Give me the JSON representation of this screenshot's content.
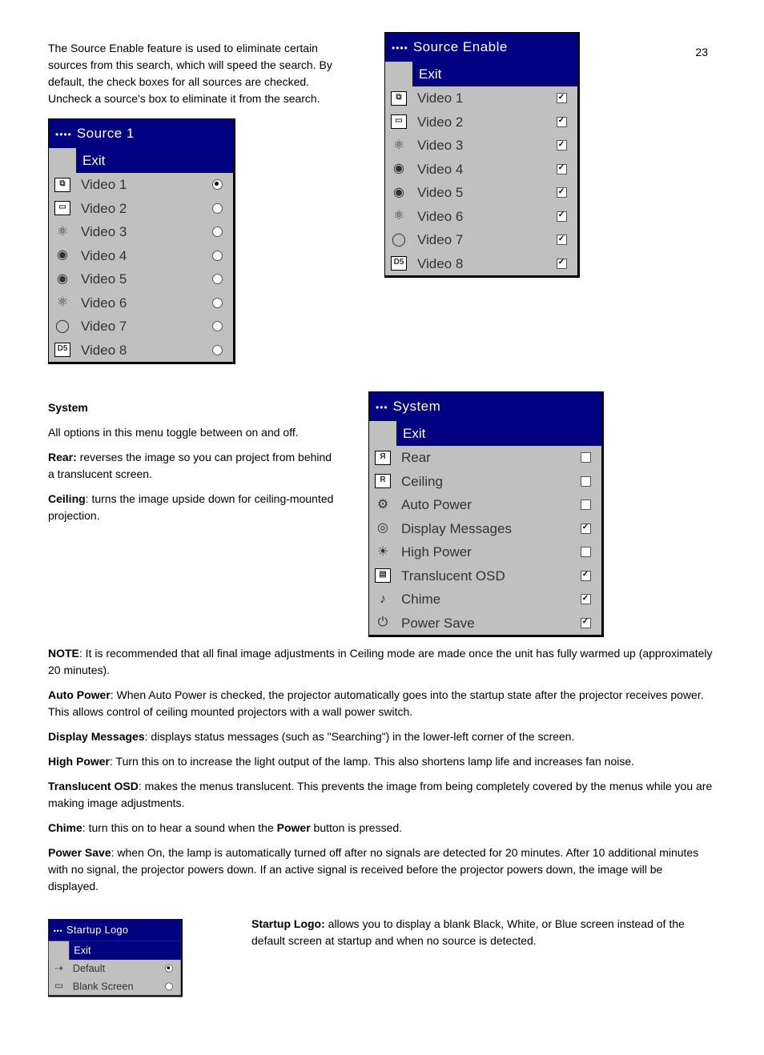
{
  "page_number": "23",
  "intro_para": "The Source Enable feature is used to eliminate certain sources from this search, which will speed the search. By default, the check boxes for all sources are checked. Uncheck a source's box to eliminate it from the search.",
  "menu_source1": {
    "title": "Source 1",
    "dots": "••••",
    "exit": "Exit",
    "items": [
      {
        "label": "Video 1",
        "selected": true
      },
      {
        "label": "Video 2",
        "selected": false
      },
      {
        "label": "Video 3",
        "selected": false
      },
      {
        "label": "Video 4",
        "selected": false
      },
      {
        "label": "Video 5",
        "selected": false
      },
      {
        "label": "Video 6",
        "selected": false
      },
      {
        "label": "Video 7",
        "selected": false
      },
      {
        "label": "Video 8",
        "selected": false
      }
    ]
  },
  "menu_source_enable": {
    "title": "Source Enable",
    "dots": "••••",
    "exit": "Exit",
    "items": [
      {
        "label": "Video 1",
        "checked": true
      },
      {
        "label": "Video 2",
        "checked": true
      },
      {
        "label": "Video 3",
        "checked": true
      },
      {
        "label": "Video 4",
        "checked": true
      },
      {
        "label": "Video 5",
        "checked": true
      },
      {
        "label": "Video 6",
        "checked": true
      },
      {
        "label": "Video 7",
        "checked": true
      },
      {
        "label": "Video 8",
        "checked": true
      }
    ]
  },
  "system_heading": "System",
  "system_intro": "All options in this menu toggle between on and off.",
  "rear_label": "Rear:",
  "rear_text": " reverses the image so you can project from behind a translucent screen.",
  "ceiling_label": "Ceiling",
  "ceiling_text": ": turns the image upside down for ceiling-mounted projection.",
  "menu_system": {
    "title": "System",
    "dots": "•••",
    "exit": "Exit",
    "items": [
      {
        "label": "Rear",
        "checked": false
      },
      {
        "label": "Ceiling",
        "checked": false
      },
      {
        "label": "Auto Power",
        "checked": false
      },
      {
        "label": "Display Messages",
        "checked": true
      },
      {
        "label": "High Power",
        "checked": false
      },
      {
        "label": "Translucent OSD",
        "checked": true
      },
      {
        "label": "Chime",
        "checked": true
      },
      {
        "label": "Power Save",
        "checked": true
      }
    ]
  },
  "note_label": "NOTE",
  "note_text": ": It is recommended that all final image adjustments in Ceiling mode are made once the unit has fully warmed up (approximately 20 minutes).",
  "auto_power_label": "Auto Power",
  "auto_power_text": ": When Auto Power is checked, the projector automatically goes into the startup state after the projector receives power. This allows control of ceiling mounted projectors with a wall power switch.",
  "display_messages_label": "Display Messages",
  "display_messages_text": ": displays status messages (such as \"Searching\") in the lower-left corner of the screen.",
  "high_power_label": "High Power",
  "high_power_text": ": Turn this on to increase the light output of the lamp. This also shortens lamp life and increases fan noise.",
  "translucent_label": "Translucent OSD",
  "translucent_text": ": makes the menus translucent. This prevents the image from being completely covered by the menus while you are making image adjustments.",
  "chime_label": "Chime",
  "chime_text": ": turn this on to hear a sound when the ",
  "chime_bold": "Power",
  "chime_text2": " button is pressed.",
  "power_save_label": "Power Save",
  "power_save_text": ": when On, the lamp is automatically turned off after no signals are detected for 20 minutes. After 10 additional minutes with no signal, the projector powers down. If an active signal is received before the projector powers down, the image will be displayed.",
  "menu_startup": {
    "title": "Startup Logo",
    "dots": "•••",
    "exit": "Exit",
    "items": [
      {
        "label": "Default",
        "selected": true
      },
      {
        "label": "Blank Screen",
        "selected": false
      }
    ]
  },
  "startup_label": "Startup Logo:",
  "startup_text": " allows you to display a blank Black, White, or Blue screen instead of the default screen at startup and when no source is detected."
}
